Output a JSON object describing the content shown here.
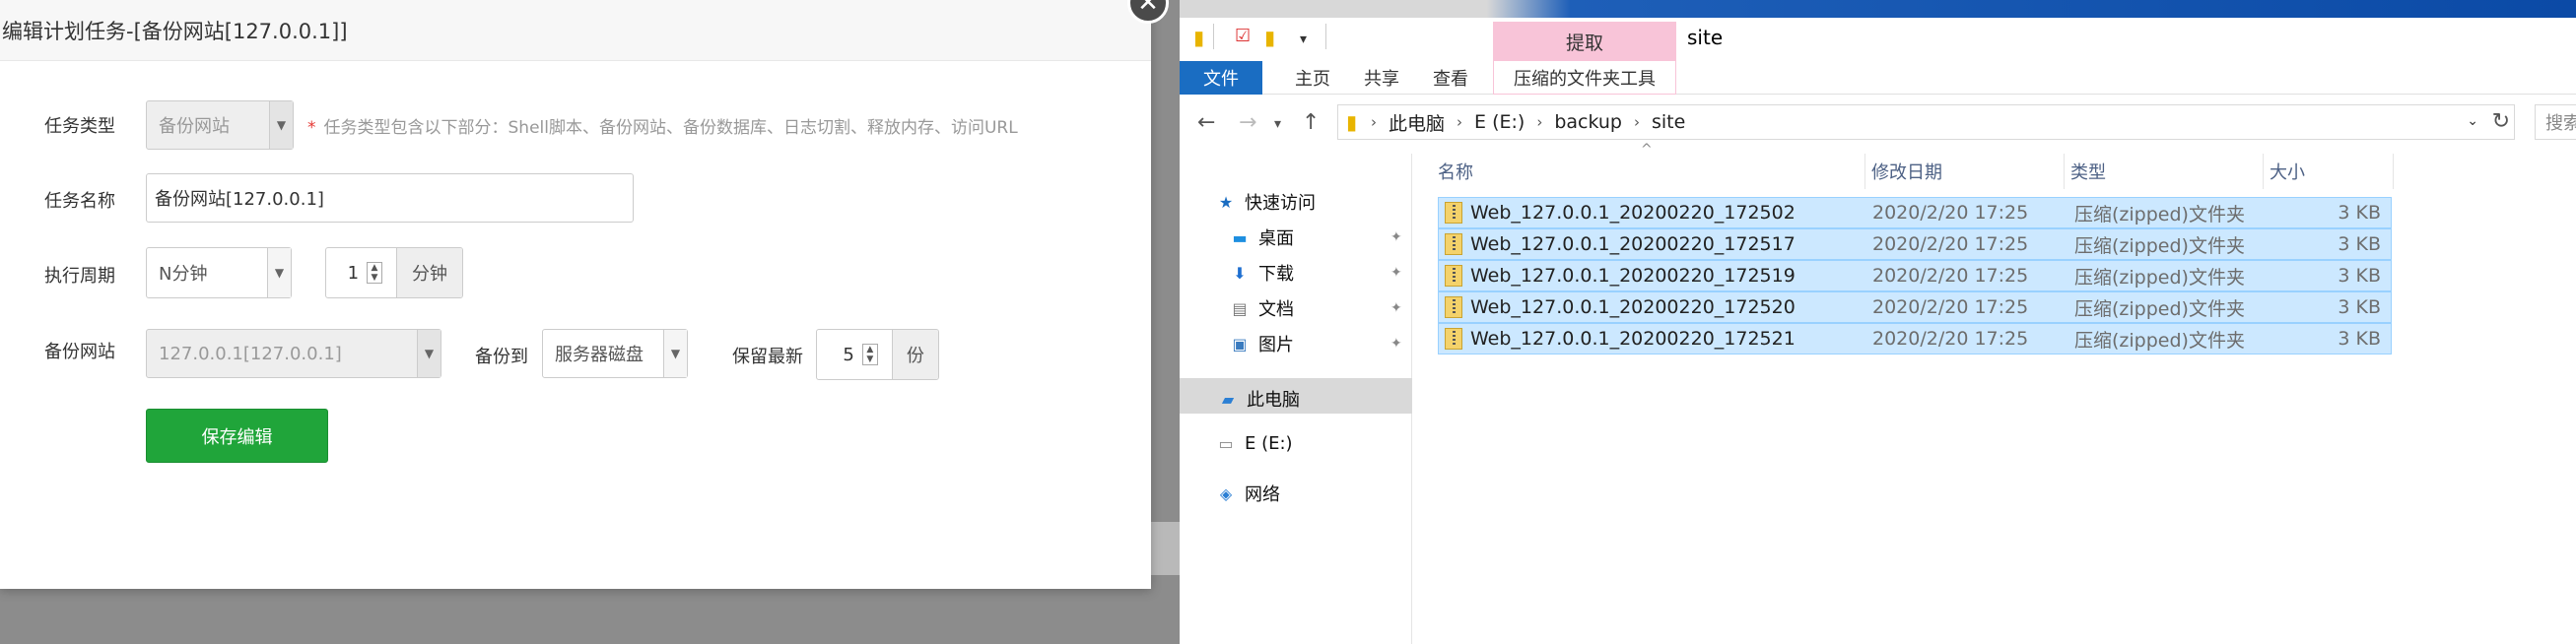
{
  "dialog": {
    "title": "编辑计划任务-[备份网站[127.0.0.1]]",
    "close_glyph": "✕",
    "task_type": {
      "label": "任务类型",
      "value": "备份网站",
      "hint_star": "*",
      "hint": "任务类型包含以下部分：Shell脚本、备份网站、备份数据库、日志切割、释放内存、访问URL"
    },
    "task_name": {
      "label": "任务名称",
      "value": "备份网站[127.0.0.1]"
    },
    "cycle": {
      "label": "执行周期",
      "value": "N分钟",
      "number": "1",
      "unit": "分钟"
    },
    "backup_site": {
      "label": "备份网站",
      "value": "127.0.0.1[127.0.0.1]"
    },
    "backup_to": {
      "label": "备份到",
      "value": "服务器磁盘"
    },
    "keep_latest": {
      "label": "保留最新",
      "number": "5",
      "unit": "份"
    },
    "save_label": "保存编辑"
  },
  "explorer": {
    "window_title": "site",
    "context_group": "提取",
    "tabs": [
      "文件",
      "主页",
      "共享",
      "查看",
      "压缩的文件夹工具"
    ],
    "breadcrumb": [
      "此电脑",
      "E (E:)",
      "backup",
      "site"
    ],
    "search_placeholder": "搜索",
    "nav": {
      "quick_access": "快速访问",
      "desktop": "桌面",
      "downloads": "下载",
      "documents": "文档",
      "pictures": "图片",
      "this_pc": "此电脑",
      "drive_e": "E (E:)",
      "network": "网络"
    },
    "columns": {
      "name": "名称",
      "modified": "修改日期",
      "type": "类型",
      "size": "大小"
    },
    "files": [
      {
        "name": "Web_127.0.0.1_20200220_172502",
        "modified": "2020/2/20 17:25",
        "type": "压缩(zipped)文件夹",
        "size": "3 KB"
      },
      {
        "name": "Web_127.0.0.1_20200220_172517",
        "modified": "2020/2/20 17:25",
        "type": "压缩(zipped)文件夹",
        "size": "3 KB"
      },
      {
        "name": "Web_127.0.0.1_20200220_172519",
        "modified": "2020/2/20 17:25",
        "type": "压缩(zipped)文件夹",
        "size": "3 KB"
      },
      {
        "name": "Web_127.0.0.1_20200220_172520",
        "modified": "2020/2/20 17:25",
        "type": "压缩(zipped)文件夹",
        "size": "3 KB"
      },
      {
        "name": "Web_127.0.0.1_20200220_172521",
        "modified": "2020/2/20 17:25",
        "type": "压缩(zipped)文件夹",
        "size": "3 KB"
      }
    ]
  },
  "colors": {
    "accent_green": "#20a53a",
    "file_tab_blue": "#1a6dc2",
    "context_pink": "#f8c4d8",
    "selection_blue": "#cce8ff"
  }
}
